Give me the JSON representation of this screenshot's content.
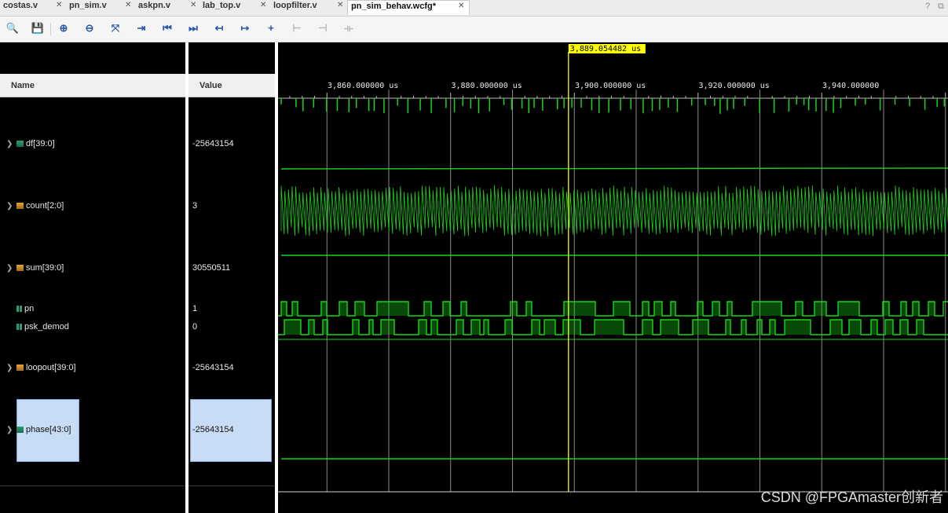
{
  "tabs": [
    {
      "label": "costas.v",
      "active": false
    },
    {
      "label": "pn_sim.v",
      "active": false
    },
    {
      "label": "askpn.v",
      "active": false
    },
    {
      "label": "lab_top.v",
      "active": false
    },
    {
      "label": "loopfilter.v",
      "active": false
    },
    {
      "label": "pn_sim_behav.wcfg*",
      "active": true
    }
  ],
  "window_controls": {
    "help": "?",
    "restore": "⧉"
  },
  "toolbar": [
    {
      "icon": "search-icon",
      "glyph": "🔍",
      "enabled": true
    },
    {
      "icon": "save-icon",
      "glyph": "💾",
      "enabled": true
    },
    {
      "icon": "zoom-in-icon",
      "glyph": "⊕",
      "enabled": true
    },
    {
      "icon": "zoom-out-icon",
      "glyph": "⊖",
      "enabled": true
    },
    {
      "icon": "zoom-fit-icon",
      "glyph": "⤧",
      "enabled": true
    },
    {
      "icon": "go-to-cursor-icon",
      "glyph": "⇥",
      "enabled": true
    },
    {
      "icon": "go-to-time-zero-icon",
      "glyph": "⏮",
      "enabled": true
    },
    {
      "icon": "go-to-last-time-icon",
      "glyph": "⏭",
      "enabled": true
    },
    {
      "icon": "previous-transition-icon",
      "glyph": "↤",
      "enabled": true
    },
    {
      "icon": "next-transition-icon",
      "glyph": "↦",
      "enabled": true
    },
    {
      "icon": "add-marker-icon",
      "glyph": "+",
      "enabled": true
    },
    {
      "icon": "previous-marker-icon",
      "glyph": "⊢",
      "enabled": false
    },
    {
      "icon": "next-marker-icon",
      "glyph": "⊣",
      "enabled": false
    },
    {
      "icon": "swap-cursors-icon",
      "glyph": "⟛",
      "enabled": false
    }
  ],
  "columns": {
    "name": "Name",
    "value": "Value"
  },
  "signals": [
    {
      "name": "df[39:0]",
      "value": "-25643154",
      "type": "bus",
      "expandable": true,
      "selected": false
    },
    {
      "name": "count[2:0]",
      "value": "3",
      "type": "bus",
      "expandable": true,
      "selected": false
    },
    {
      "name": "sum[39:0]",
      "value": "30550511",
      "type": "bus",
      "expandable": true,
      "selected": false
    },
    {
      "name": "pn",
      "value": "1",
      "type": "bit",
      "expandable": false,
      "selected": false
    },
    {
      "name": "psk_demod",
      "value": "0",
      "type": "bit",
      "expandable": false,
      "selected": false
    },
    {
      "name": "loopout[39:0]",
      "value": "-25643154",
      "type": "bus",
      "expandable": true,
      "selected": false
    },
    {
      "name": "phase[43:0]",
      "value": "-25643154",
      "type": "bus",
      "expandable": true,
      "selected": true
    }
  ],
  "timeline": {
    "cursor_label": "3,889.054482 us",
    "cursor_time_us": 3889.054482,
    "ticks": [
      {
        "label": "3,860.000000 us",
        "time_us": 3860
      },
      {
        "label": "3,880.000000 us",
        "time_us": 3880
      },
      {
        "label": "3,900.000000 us",
        "time_us": 3900
      },
      {
        "label": "3,920.000000 us",
        "time_us": 3920
      },
      {
        "label": "3,940.000000",
        "time_us": 3940
      }
    ]
  },
  "colors": {
    "waveform": "#19d419",
    "cursor": "#ffff00",
    "cursor_label_bg": "#ffff00",
    "grid": "#8a8a8a",
    "selection": "#c9dcf6"
  },
  "watermark": "CSDN @FPGAmaster创新者"
}
